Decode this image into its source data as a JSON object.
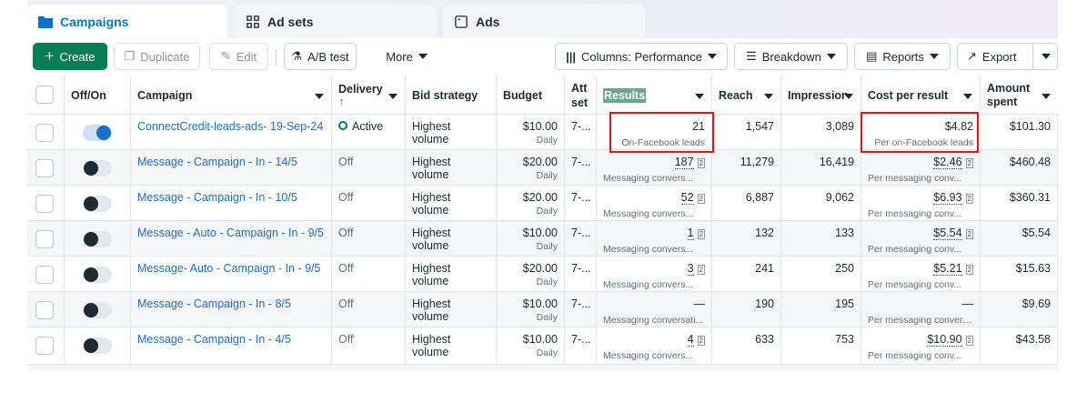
{
  "tabs": [
    {
      "label": "Campaigns",
      "icon": "folder-icon"
    },
    {
      "label": "Ad sets",
      "icon": "grid-icon"
    },
    {
      "label": "Ads",
      "icon": "window-icon"
    }
  ],
  "toolbar": {
    "create": "Create",
    "duplicate": "Duplicate",
    "edit": "Edit",
    "ab_test": "A/B test",
    "more": "More",
    "columns": "Columns: Performance",
    "breakdown": "Breakdown",
    "reports": "Reports",
    "export": "Export"
  },
  "headers": {
    "offon": "Off/On",
    "campaign": "Campaign",
    "delivery": "Delivery",
    "delivery_sort": "↑",
    "bid": "Bid strategy",
    "budget": "Budget",
    "att": "Att set",
    "results": "Results",
    "reach": "Reach",
    "impressions": "Impression",
    "cost": "Cost per result",
    "amount": "Amount spent"
  },
  "colors": {
    "accent": "#077d55",
    "link": "#1d6fd6",
    "highlight": "#e4161b"
  },
  "rows": [
    {
      "on": true,
      "campaign": "ConnectCredit-leads-ads- 19-Sep-24",
      "delivery": "Active",
      "bid": "Highest volume",
      "budget": "$10.00",
      "budget_sub": "Daily",
      "att": "7-...",
      "results": "21",
      "results_sub": "On-Facebook leads",
      "reach": "1,547",
      "impressions": "3,089",
      "cost": "$4.82",
      "cost_sub": "Per on-Facebook leads",
      "amount": "$101.30"
    },
    {
      "on": false,
      "campaign": "Message - Campaign - In - 14/5",
      "delivery": "Off",
      "bid": "Highest volume",
      "budget": "$20.00",
      "budget_sub": "Daily",
      "att": "7-...",
      "results": "187",
      "results_sub": "Messaging convers...",
      "reach": "11,279",
      "impressions": "16,419",
      "cost": "$2.46",
      "cost_sub": "Per messaging conv...",
      "amount": "$460.48"
    },
    {
      "on": false,
      "campaign": "Message - Campaign - In - 10/5",
      "delivery": "Off",
      "bid": "Highest volume",
      "budget": "$20.00",
      "budget_sub": "Daily",
      "att": "7-...",
      "results": "52",
      "results_sub": "Messaging convers...",
      "reach": "6,887",
      "impressions": "9,062",
      "cost": "$6.93",
      "cost_sub": "Per messaging conv...",
      "amount": "$360.31"
    },
    {
      "on": false,
      "campaign": "Message - Auto - Campaign - In - 9/5",
      "delivery": "Off",
      "bid": "Highest volume",
      "budget": "$10.00",
      "budget_sub": "Daily",
      "att": "7-...",
      "results": "1",
      "results_sub": "Messaging convers...",
      "reach": "132",
      "impressions": "133",
      "cost": "$5.54",
      "cost_sub": "Per messaging conv...",
      "amount": "$5.54"
    },
    {
      "on": false,
      "campaign": "Message- Auto - Campaign - In - 9/5",
      "delivery": "Off",
      "bid": "Highest volume",
      "budget": "$20.00",
      "budget_sub": "Daily",
      "att": "7-...",
      "results": "3",
      "results_sub": "Messaging convers...",
      "reach": "241",
      "impressions": "250",
      "cost": "$5.21",
      "cost_sub": "Per messaging conv...",
      "amount": "$15.63"
    },
    {
      "on": false,
      "campaign": "Message - Campaign - In - 8/5",
      "delivery": "Off",
      "bid": "Highest volume",
      "budget": "$10.00",
      "budget_sub": "Daily",
      "att": "7-...",
      "results": "—",
      "results_sub": "Messaging conversati...",
      "reach": "190",
      "impressions": "195",
      "cost": "—",
      "cost_sub": "Per messaging convers...",
      "amount": "$9.69"
    },
    {
      "on": false,
      "campaign": "Message - Campaign - In - 4/5",
      "delivery": "Off",
      "bid": "Highest volume",
      "budget": "$10.00",
      "budget_sub": "Daily",
      "att": "7-...",
      "results": "4",
      "results_sub": "Messaging convers...",
      "reach": "633",
      "impressions": "753",
      "cost": "$10.90",
      "cost_sub": "Per messaging conv...",
      "amount": "$43.58"
    }
  ]
}
